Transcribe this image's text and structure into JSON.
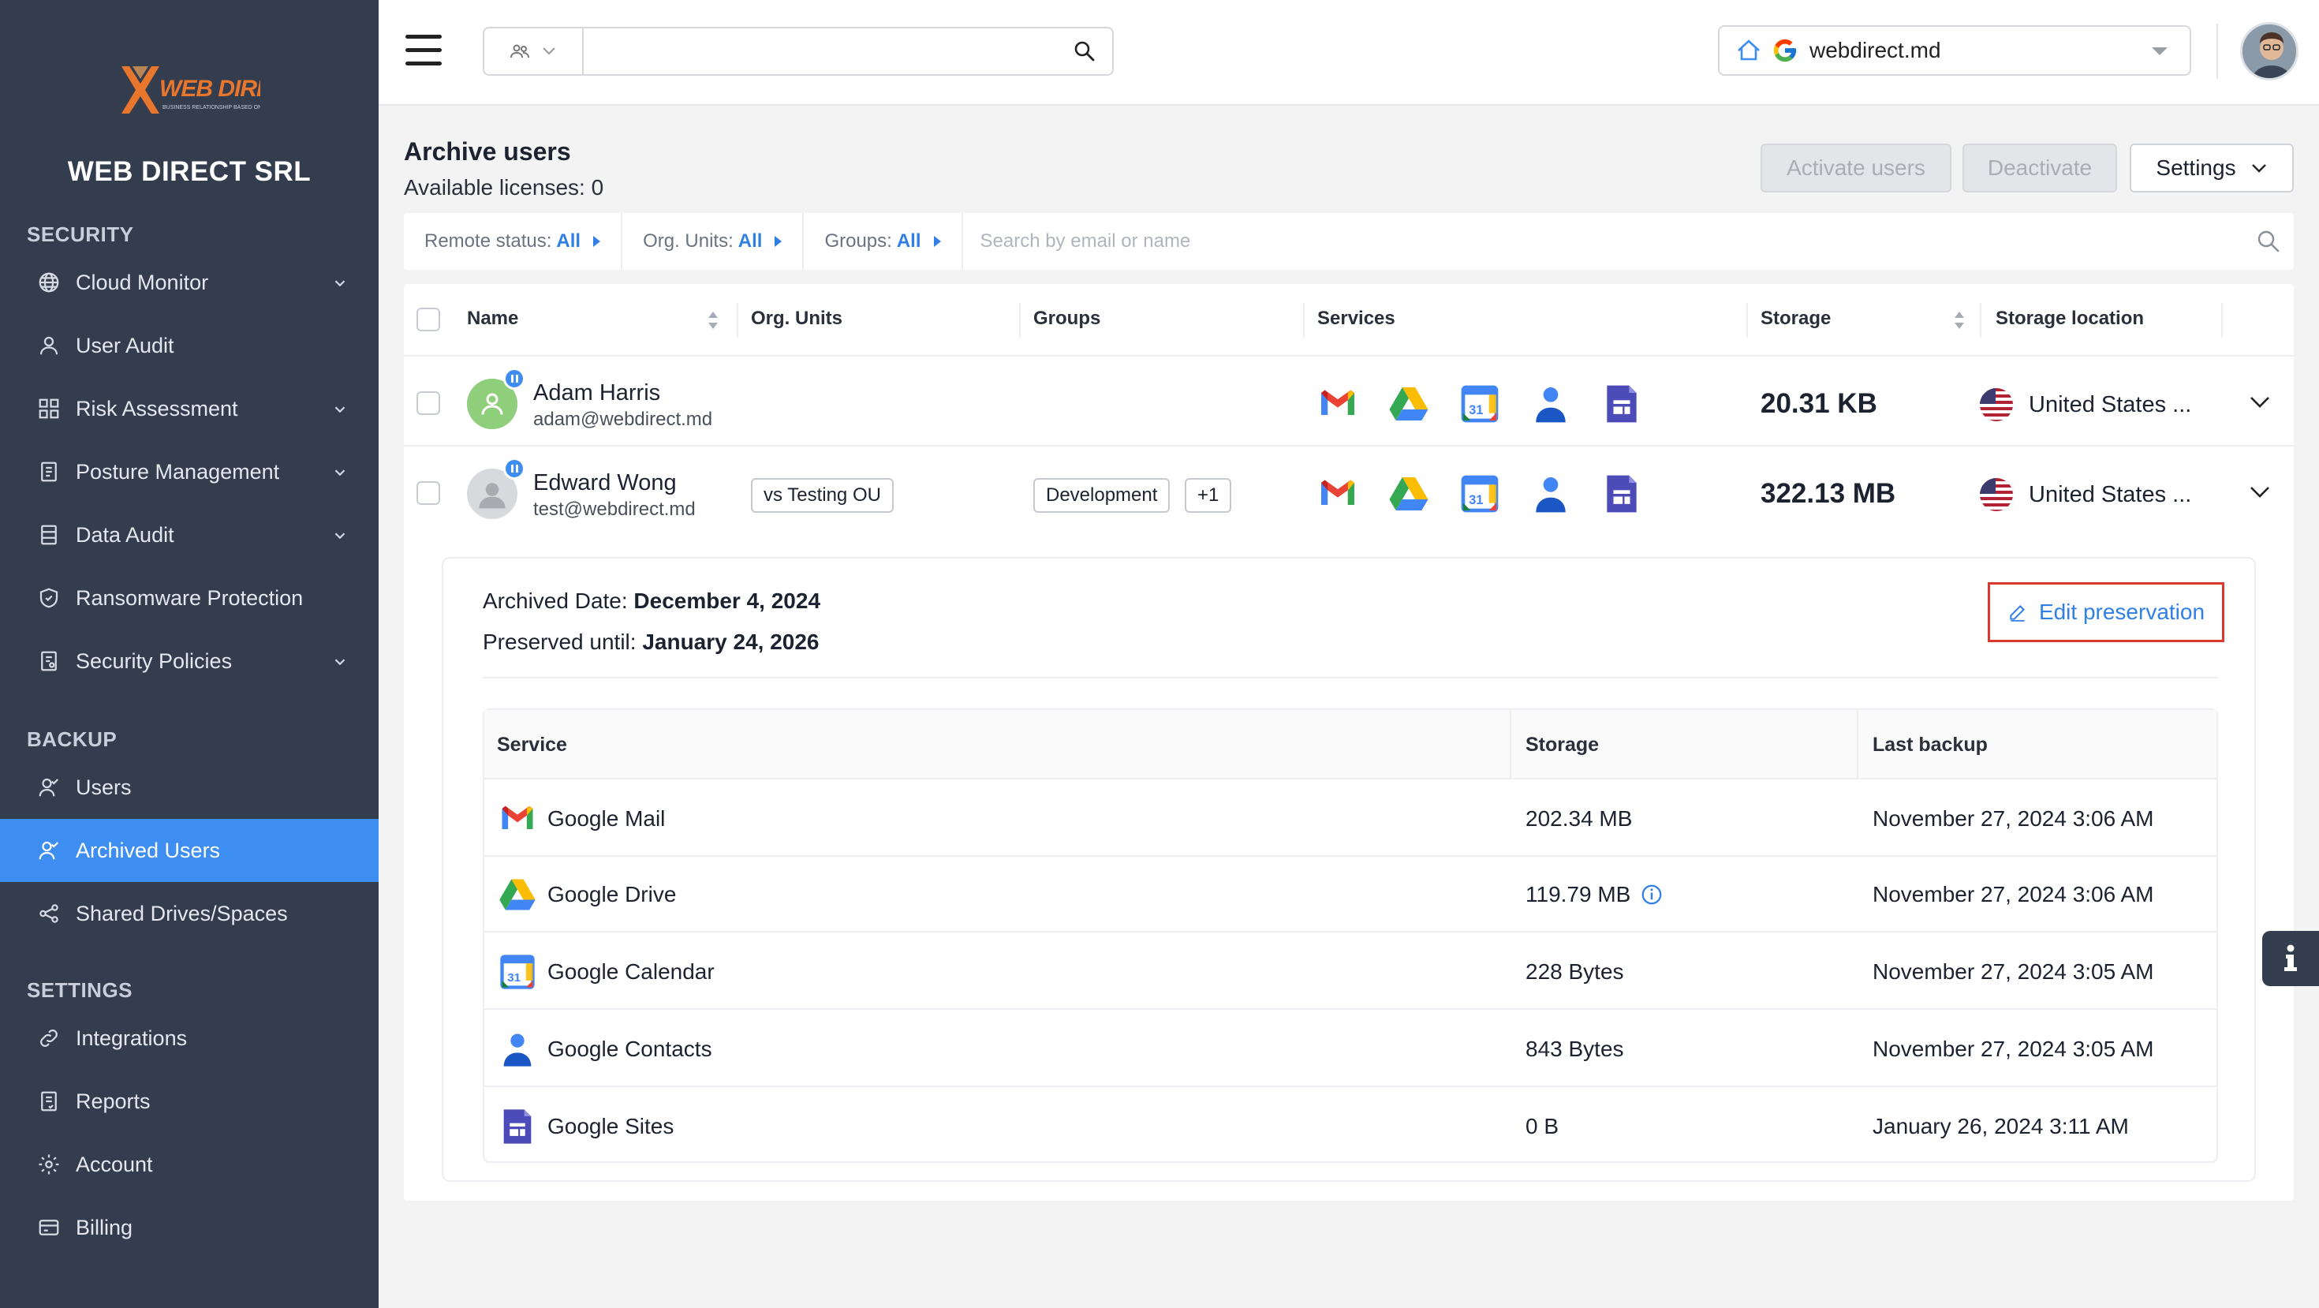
{
  "sidebar": {
    "company": "WEB DIRECT SRL",
    "logo_text": "WEB DIRECT",
    "logo_tagline": "BUSINESS RELATIONSHIP BASED ON TRUST",
    "sections": {
      "security": "SECURITY",
      "backup": "BACKUP",
      "settings": "SETTINGS"
    },
    "security_items": [
      {
        "label": "Cloud Monitor",
        "icon": "globe-icon"
      },
      {
        "label": "User Audit",
        "icon": "user-icon"
      },
      {
        "label": "Risk Assessment",
        "icon": "grid-icon"
      },
      {
        "label": "Posture Management",
        "icon": "clipboard-icon"
      },
      {
        "label": "Data Audit",
        "icon": "database-icon"
      },
      {
        "label": "Ransomware Protection",
        "icon": "shield-icon"
      },
      {
        "label": "Security Policies",
        "icon": "policy-icon"
      }
    ],
    "backup_items": [
      {
        "label": "Users",
        "icon": "users-icon"
      },
      {
        "label": "Archived Users",
        "icon": "archived-users-icon"
      },
      {
        "label": "Shared Drives/Spaces",
        "icon": "share-icon"
      }
    ],
    "settings_items": [
      {
        "label": "Integrations",
        "icon": "link-icon"
      },
      {
        "label": "Reports",
        "icon": "report-icon"
      },
      {
        "label": "Account",
        "icon": "gear-icon"
      },
      {
        "label": "Billing",
        "icon": "card-icon"
      }
    ]
  },
  "topbar": {
    "search_placeholder": "",
    "domain": "webdirect.md"
  },
  "page": {
    "title": "Archive users",
    "licenses": "Available licenses: 0",
    "activate_label": "Activate users",
    "deactivate_label": "Deactivate",
    "settings_label": "Settings"
  },
  "filters": {
    "remote_status_label": "Remote status:",
    "remote_status_value": "All",
    "org_units_label": "Org. Units:",
    "org_units_value": "All",
    "groups_label": "Groups:",
    "groups_value": "All",
    "search_placeholder": "Search by email or name"
  },
  "table": {
    "headers": {
      "name": "Name",
      "org_units": "Org. Units",
      "groups": "Groups",
      "services": "Services",
      "storage": "Storage",
      "storage_location": "Storage location"
    },
    "rows": [
      {
        "name": "Adam Harris",
        "email": "adam@webdirect.md",
        "org_unit": "",
        "group": "",
        "group_more": "",
        "storage": "20.31 KB",
        "location": "United States ..."
      },
      {
        "name": "Edward Wong",
        "email": "test@webdirect.md",
        "org_unit": "vs Testing OU",
        "group": "Development",
        "group_more": "+1",
        "storage": "322.13 MB",
        "location": "United States ..."
      }
    ]
  },
  "detail": {
    "archived_label": "Archived Date:",
    "archived_value": "December 4, 2024",
    "preserved_label": "Preserved until:",
    "preserved_value": "January 24, 2026",
    "edit_label": "Edit preservation",
    "headers": {
      "service": "Service",
      "storage": "Storage",
      "last_backup": "Last backup"
    },
    "services": [
      {
        "name": "Google Mail",
        "storage": "202.34 MB",
        "last_backup": "November 27, 2024 3:06 AM",
        "icon": "gmail-icon"
      },
      {
        "name": "Google Drive",
        "storage": "119.79 MB",
        "last_backup": "November 27, 2024 3:06 AM",
        "icon": "drive-icon"
      },
      {
        "name": "Google Calendar",
        "storage": "228 Bytes",
        "last_backup": "November 27, 2024 3:05 AM",
        "icon": "calendar-icon"
      },
      {
        "name": "Google Contacts",
        "storage": "843 Bytes",
        "last_backup": "November 27, 2024 3:05 AM",
        "icon": "contacts-icon"
      },
      {
        "name": "Google Sites",
        "storage": "0 B",
        "last_backup": "January 26, 2024 3:11 AM",
        "icon": "sites-icon"
      }
    ]
  },
  "colors": {
    "sidebar_bg": "#343d4e",
    "accent": "#3d8ef0",
    "link": "#2f7fe6",
    "highlight_border": "#d93a2f"
  }
}
